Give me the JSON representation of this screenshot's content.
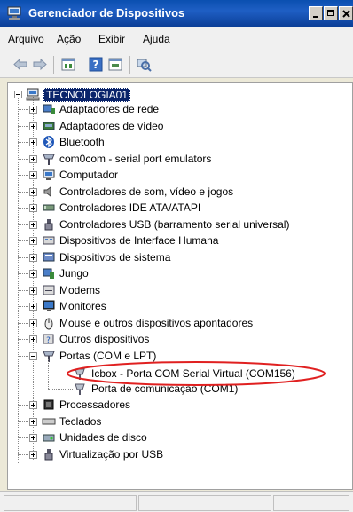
{
  "window": {
    "title": "Gerenciador de Dispositivos"
  },
  "menubar": {
    "items": [
      "Arquivo",
      "Ação",
      "Exibir",
      "Ajuda"
    ]
  },
  "toolbar": {
    "icons": [
      "back-arrow-icon",
      "forward-arrow-icon",
      "properties-icon",
      "help-icon",
      "view-icon",
      "scan-hardware-icon"
    ]
  },
  "tree": {
    "root": "TECNOLOGIA01",
    "categories": [
      "Adaptadores de rede",
      "Adaptadores de vídeo",
      "Bluetooth",
      "com0com - serial port emulators",
      "Computador",
      "Controladores de som, vídeo e jogos",
      "Controladores IDE ATA/ATAPI",
      "Controladores USB (barramento serial universal)",
      "Dispositivos de Interface Humana",
      "Dispositivos de sistema",
      "Jungo",
      "Modems",
      "Monitores",
      "Mouse e outros dispositivos apontadores",
      "Outros dispositivos",
      "Portas (COM e LPT)"
    ],
    "ports_children": [
      "Icbox - Porta COM Serial Virtual (COM156)",
      "Porta de comunicação (COM1)"
    ],
    "categories_after": [
      "Processadores",
      "Teclados",
      "Unidades de disco",
      "Virtualização por USB"
    ]
  },
  "highlight": {
    "color": "#e02020"
  }
}
